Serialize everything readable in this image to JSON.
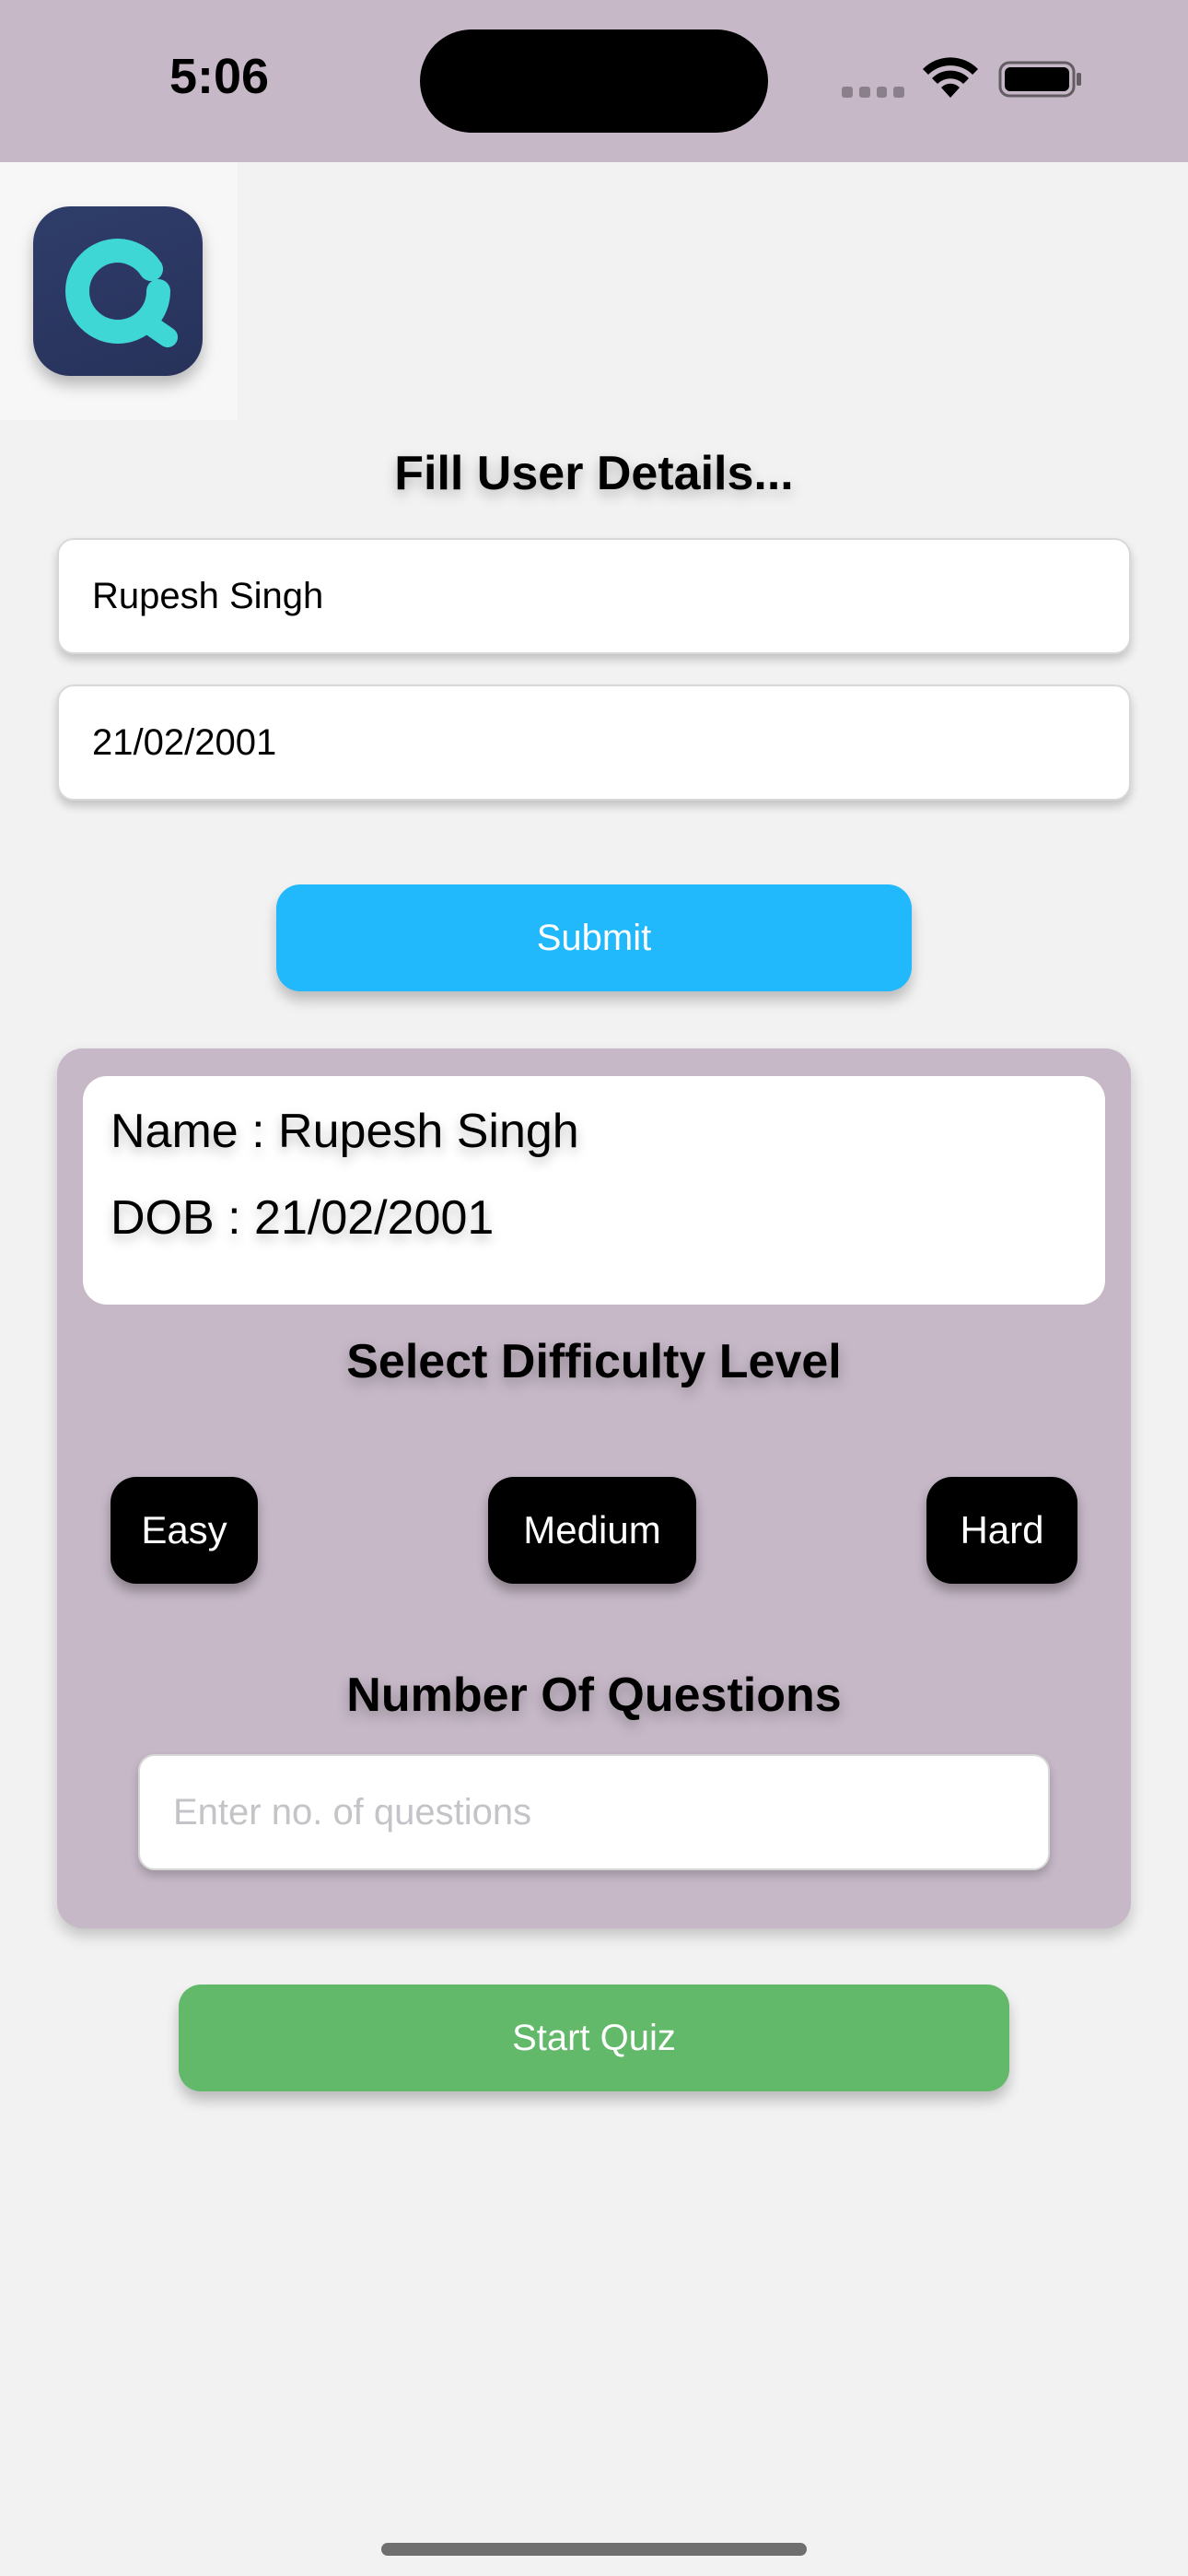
{
  "status_bar": {
    "time": "5:06",
    "icons": [
      "signal-icon",
      "wifi-icon",
      "battery-icon"
    ]
  },
  "app": {
    "logo_icon": "quiz-app-logo-icon",
    "title": "Fill User Details..."
  },
  "form": {
    "name_value": "Rupesh Singh",
    "dob_value": "21/02/2001",
    "submit_label": "Submit"
  },
  "details": {
    "name_line": "Name : Rupesh Singh",
    "dob_line": "DOB : 21/02/2001"
  },
  "difficulty": {
    "heading": "Select Difficulty Level",
    "levels": [
      "Easy",
      "Medium",
      "Hard"
    ]
  },
  "questions": {
    "heading": "Number Of Questions",
    "placeholder": "Enter no. of questions",
    "value": ""
  },
  "start_label": "Start Quiz",
  "colors": {
    "status_bar_bg": "#c6b8c7",
    "panel_bg": "#c6b8c7",
    "submit_bg": "#21b9fb",
    "start_bg": "#62b96a",
    "level_bg": "#000000",
    "logo_accent": "#3fd6d6"
  }
}
